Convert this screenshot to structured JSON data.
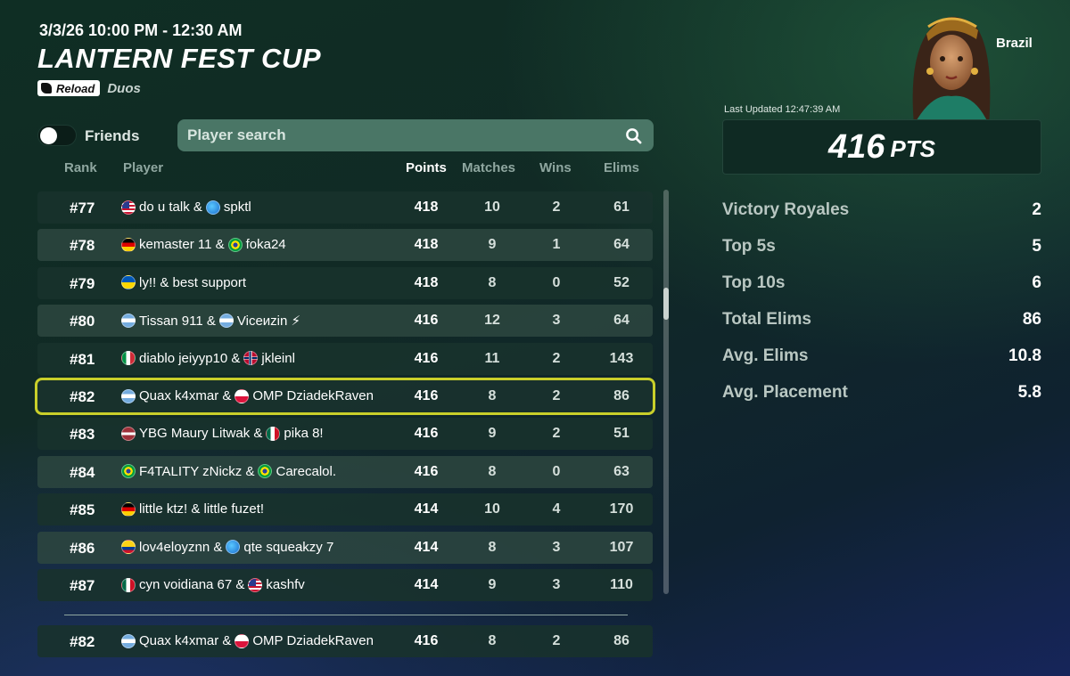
{
  "event": {
    "date_range": "3/3/26 10:00 PM - 12:30 AM",
    "title": "LANTERN FEST CUP",
    "badge": "Reload",
    "mode": "Duos"
  },
  "filters": {
    "friends_label": "Friends",
    "friends_toggle_on": false,
    "search_placeholder": "Player search",
    "search_value": ""
  },
  "columns": {
    "rank": "Rank",
    "player": "Player",
    "points": "Points",
    "matches": "Matches",
    "wins": "Wins",
    "elims": "Elims"
  },
  "rows": [
    {
      "rank": "#77",
      "p1": "do u talk &",
      "f1": "us",
      "p2": "spktl",
      "f2": "globe",
      "points": "418",
      "matches": "10",
      "wins": "2",
      "elims": "61"
    },
    {
      "rank": "#78",
      "p1": "kemaster 11 &",
      "f1": "de",
      "p2": "foka24",
      "f2": "br",
      "points": "418",
      "matches": "9",
      "wins": "1",
      "elims": "64"
    },
    {
      "rank": "#79",
      "p1": "ly!! & best support",
      "f1": "ua",
      "p2": "",
      "f2": "",
      "points": "418",
      "matches": "8",
      "wins": "0",
      "elims": "52"
    },
    {
      "rank": "#80",
      "p1": "Tissan 911 &",
      "f1": "ar",
      "p2": "Viceиzin ⚡",
      "f2": "ar",
      "points": "416",
      "matches": "12",
      "wins": "3",
      "elims": "64"
    },
    {
      "rank": "#81",
      "p1": "diablo jeiyyp10 &",
      "f1": "it",
      "p2": "jkleinl",
      "f2": "no",
      "points": "416",
      "matches": "11",
      "wins": "2",
      "elims": "143"
    },
    {
      "rank": "#82",
      "p1": "Quax k4xmar &",
      "f1": "ar",
      "p2": "OMP DziadekRaven",
      "f2": "pl",
      "points": "416",
      "matches": "8",
      "wins": "2",
      "elims": "86"
    },
    {
      "rank": "#83",
      "p1": "YBG Maury Litwak &",
      "f1": "lv",
      "p2": "pika 8!",
      "f2": "mx",
      "points": "416",
      "matches": "9",
      "wins": "2",
      "elims": "51"
    },
    {
      "rank": "#84",
      "p1": "F4TALITY zNickz &",
      "f1": "br",
      "p2": "Carecalol.",
      "f2": "br",
      "points": "416",
      "matches": "8",
      "wins": "0",
      "elims": "63"
    },
    {
      "rank": "#85",
      "p1": "little ktz! & little fuzet!",
      "f1": "de",
      "p2": "",
      "f2": "",
      "points": "414",
      "matches": "10",
      "wins": "4",
      "elims": "170"
    },
    {
      "rank": "#86",
      "p1": "lov4eloyznn &",
      "f1": "co",
      "p2": "qte squeakzy 7",
      "f2": "globe",
      "points": "414",
      "matches": "8",
      "wins": "3",
      "elims": "107"
    },
    {
      "rank": "#87",
      "p1": "cyn voidiana 67 &",
      "f1": "mx",
      "p2": "kashfv",
      "f2": "us",
      "points": "414",
      "matches": "9",
      "wins": "3",
      "elims": "110"
    }
  ],
  "highlighted_rank": "#82",
  "self_row": {
    "rank": "#82",
    "p1": "Quax k4xmar &",
    "f1": "ar",
    "p2": "OMP DziadekRaven",
    "f2": "pl",
    "points": "416",
    "matches": "8",
    "wins": "2",
    "elims": "86"
  },
  "summary": {
    "region": "Brazil",
    "last_updated": "Last Updated 12:47:39 AM",
    "points": "416",
    "points_unit": "PTS",
    "stats": [
      {
        "label": "Victory Royales",
        "value": "2"
      },
      {
        "label": "Top 5s",
        "value": "5"
      },
      {
        "label": "Top 10s",
        "value": "6"
      },
      {
        "label": "Total Elims",
        "value": "86"
      },
      {
        "label": "Avg. Elims",
        "value": "10.8"
      },
      {
        "label": "Avg. Placement",
        "value": "5.8"
      }
    ]
  },
  "colors": {
    "highlight_outline": "#c9cf2a",
    "search_bg": "#4a7666",
    "row_bg": "#18322c"
  },
  "icons": {
    "search": "search-icon",
    "reload_logo": "reload-logo-icon",
    "skin_portrait": "character-portrait"
  }
}
